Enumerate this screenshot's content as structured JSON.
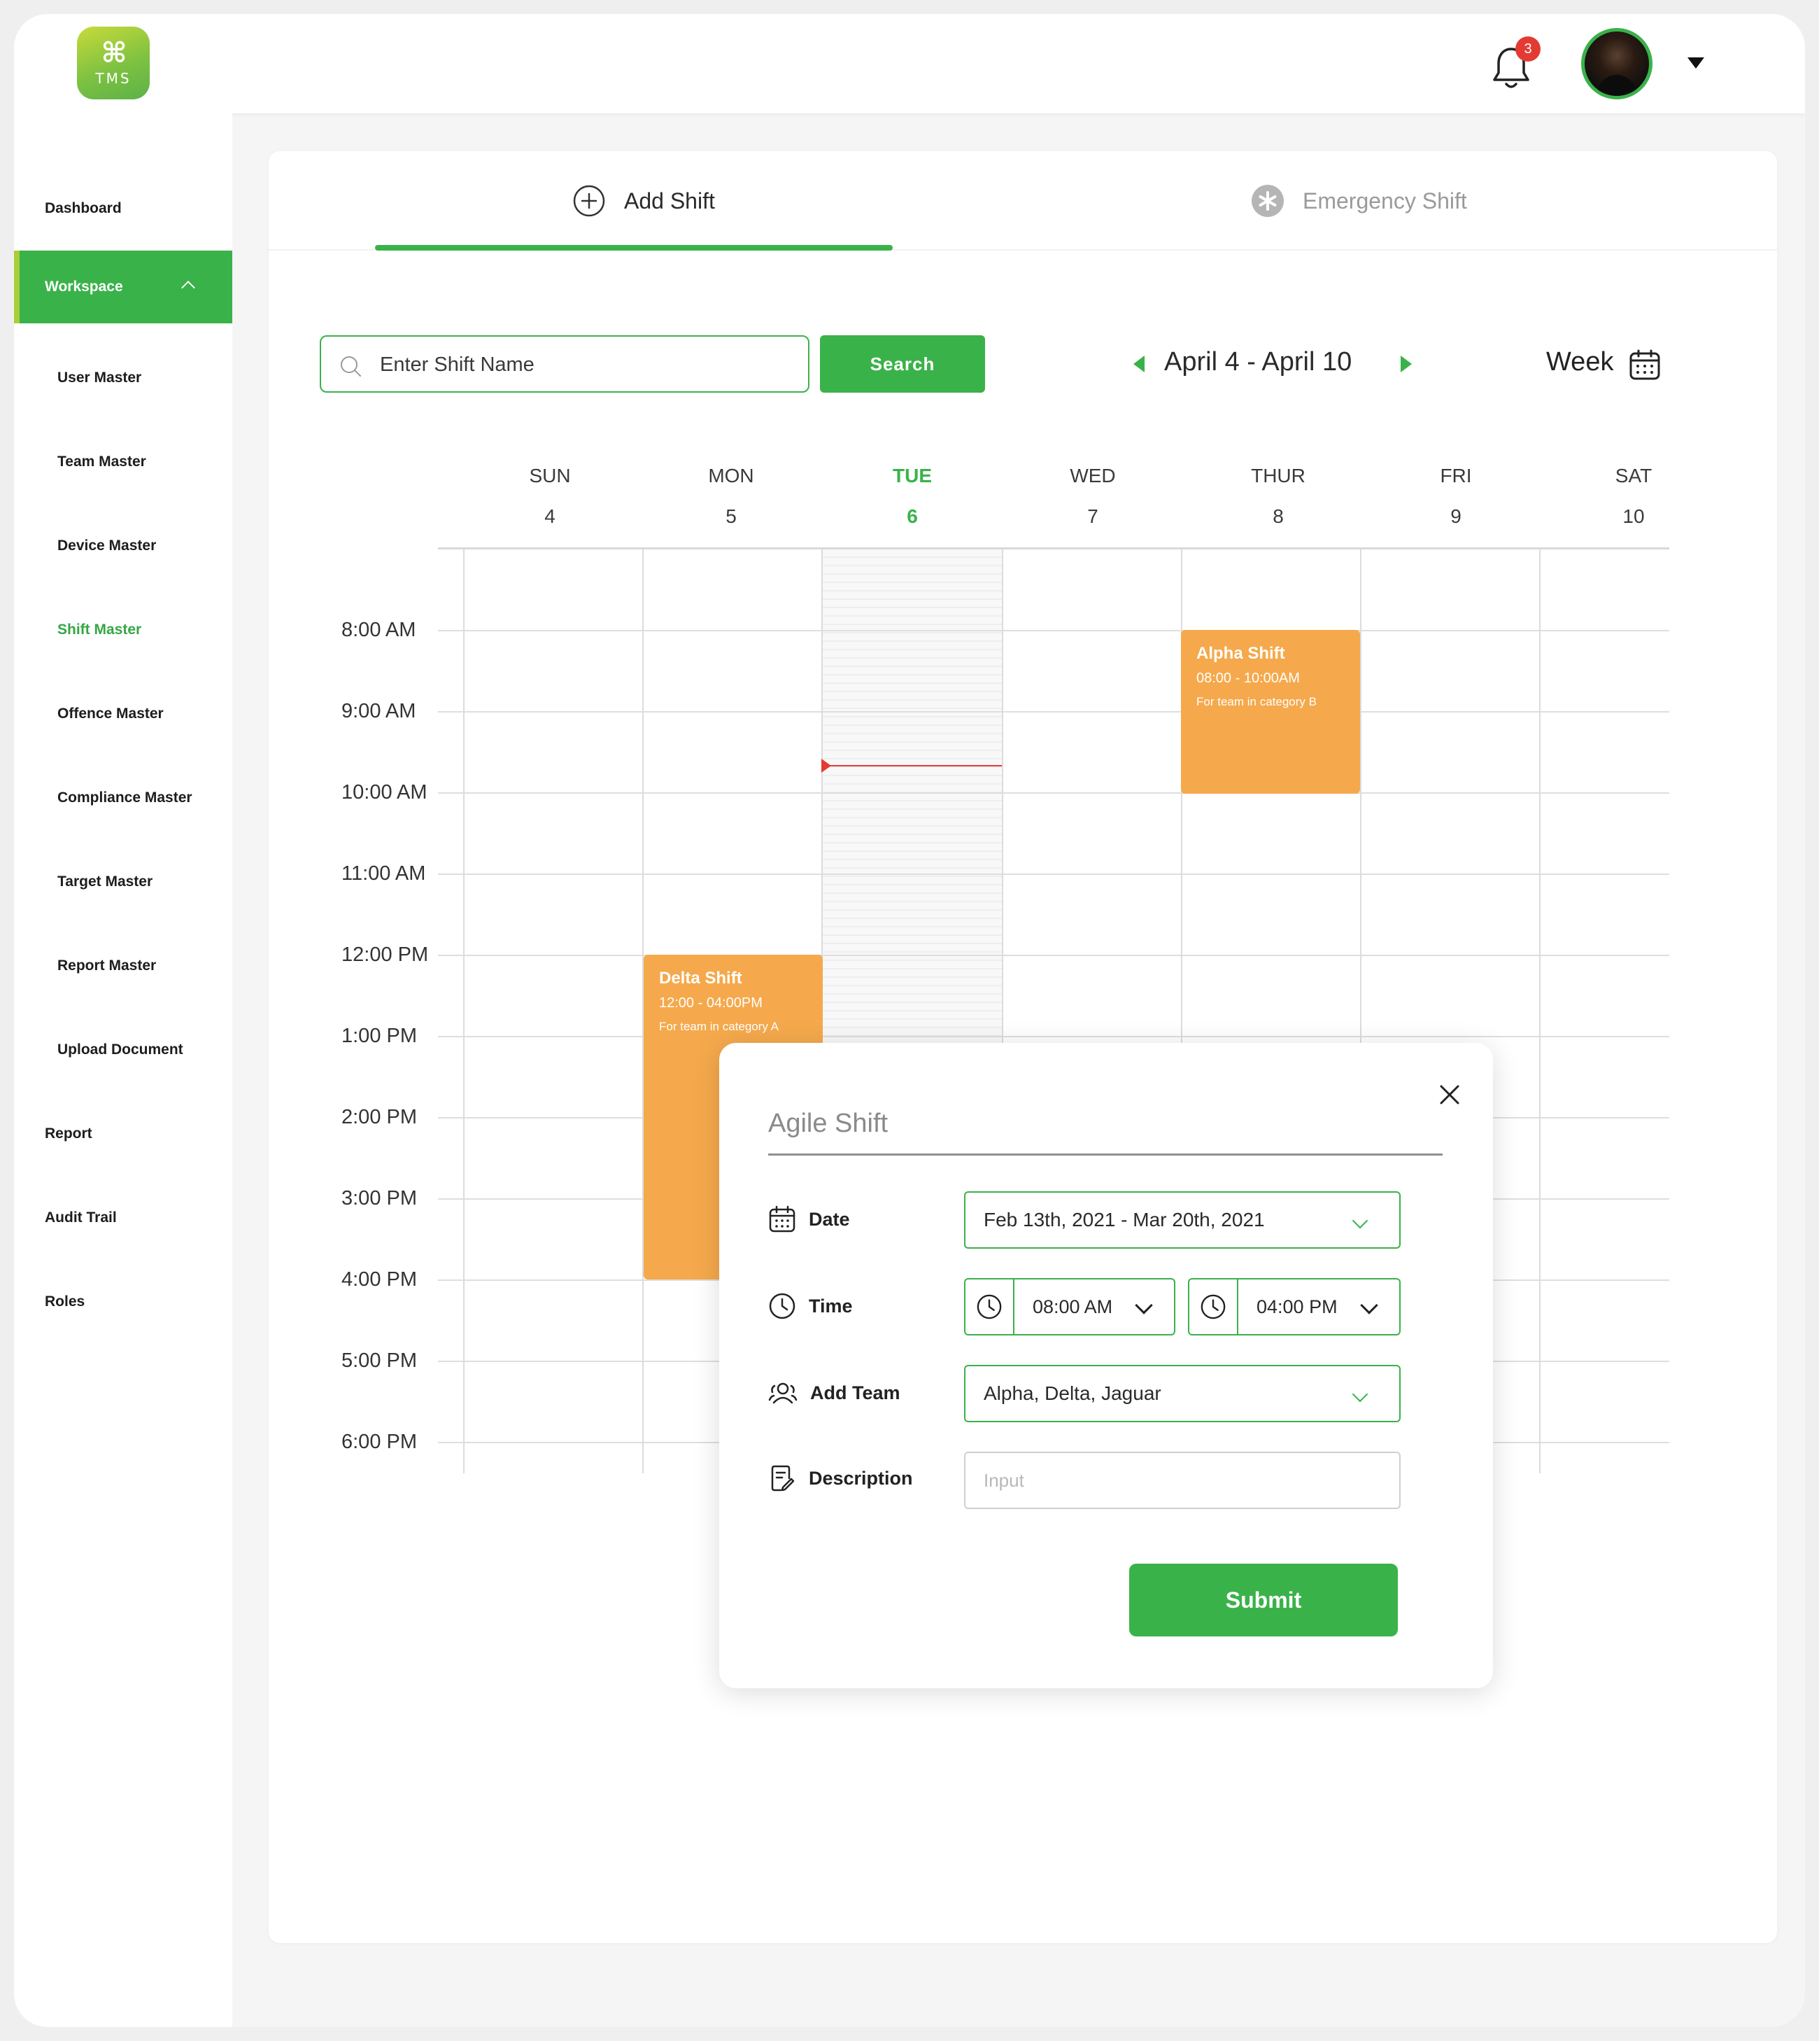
{
  "app": {
    "logo_text": "TMS",
    "notification_count": "3",
    "brand_color": "#3ab24a"
  },
  "sidebar": {
    "items": [
      {
        "label": "Dashboard",
        "level": "top"
      },
      {
        "label": "Workspace",
        "level": "top",
        "active": true
      },
      {
        "label": "User Master",
        "level": "sub"
      },
      {
        "label": "Team Master",
        "level": "sub"
      },
      {
        "label": "Device Master",
        "level": "sub"
      },
      {
        "label": "Shift Master",
        "level": "sub",
        "active": true
      },
      {
        "label": "Offence Master",
        "level": "sub"
      },
      {
        "label": "Compliance Master",
        "level": "sub"
      },
      {
        "label": "Target Master",
        "level": "sub"
      },
      {
        "label": "Report Master",
        "level": "sub"
      },
      {
        "label": "Upload Document",
        "level": "sub"
      },
      {
        "label": "Report",
        "level": "top"
      },
      {
        "label": "Audit Trail",
        "level": "top"
      },
      {
        "label": "Roles",
        "level": "top"
      }
    ]
  },
  "tabs": {
    "add_shift": "Add Shift",
    "emergency_shift": "Emergency Shift",
    "active": "add_shift"
  },
  "toolbar": {
    "search_placeholder": "Enter Shift Name",
    "search_button": "Search",
    "date_range": "April 4 - April 10",
    "view_mode": "Week"
  },
  "calendar": {
    "days": [
      {
        "name": "SUN",
        "date": "4"
      },
      {
        "name": "MON",
        "date": "5"
      },
      {
        "name": "TUE",
        "date": "6",
        "today": true
      },
      {
        "name": "WED",
        "date": "7"
      },
      {
        "name": "THUR",
        "date": "8"
      },
      {
        "name": "FRI",
        "date": "9"
      },
      {
        "name": "SAT",
        "date": "10"
      }
    ],
    "times": [
      "8:00 AM",
      "9:00 AM",
      "10:00 AM",
      "11:00 AM",
      "12:00 PM",
      "1:00 PM",
      "2:00 PM",
      "3:00 PM",
      "4:00 PM",
      "5:00 PM",
      "6:00 PM"
    ],
    "events": [
      {
        "title": "Alpha Shift",
        "time": "08:00 - 10:00AM",
        "desc": "For team in category B",
        "color": "#f5a94c"
      },
      {
        "title": "Delta Shift",
        "time": "12:00 - 04:00PM",
        "desc": "For team in category A",
        "color": "#f5a94c"
      }
    ]
  },
  "modal": {
    "title": "Agile Shift",
    "date_label": "Date",
    "date_value": "Feb 13th, 2021 - Mar 20th, 2021",
    "time_label": "Time",
    "time_start": "08:00 AM",
    "time_end": "04:00 PM",
    "team_label": "Add Team",
    "team_value": "Alpha, Delta, Jaguar",
    "description_label": "Description",
    "description_placeholder": "Input",
    "submit_label": "Submit"
  }
}
